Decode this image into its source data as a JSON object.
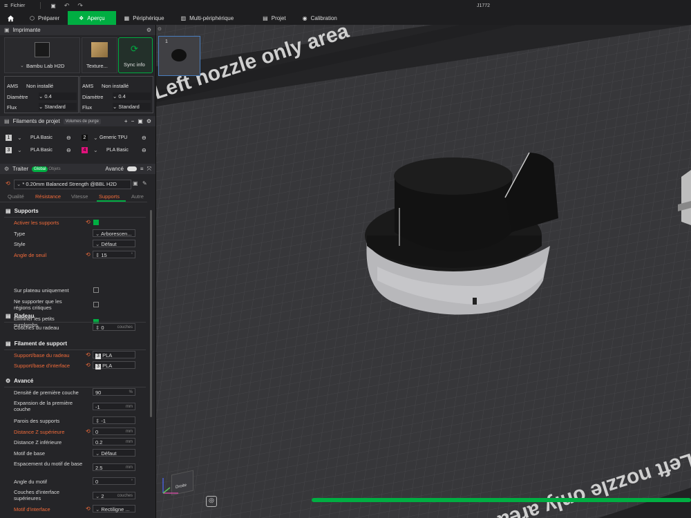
{
  "titlebar": {
    "menu_label": "Fichier",
    "project_name": "J1772"
  },
  "tabs": [
    {
      "label": "Préparer"
    },
    {
      "label": "Aperçu"
    },
    {
      "label": "Périphérique"
    },
    {
      "label": "Multi-périphérique"
    },
    {
      "label": "Projet"
    },
    {
      "label": "Calibration"
    }
  ],
  "printer": {
    "section_title": "Imprimante",
    "printer_name": "Bambu Lab H2D",
    "plate_name": "Texture...",
    "sync_label": "Sync info",
    "left": {
      "ams_label": "AMS",
      "ams_value": "Non installé",
      "diam_label": "Diamètre",
      "diam_value": "0.4",
      "flux_label": "Flux",
      "flux_value": "Standard"
    },
    "right": {
      "ams_label": "AMS",
      "ams_value": "Non installé",
      "diam_label": "Diamètre",
      "diam_value": "0.4",
      "flux_label": "Flux",
      "flux_value": "Standard"
    }
  },
  "filaments": {
    "section_title": "Filaments de projet",
    "purge_label": "Volumes de purge",
    "items": [
      {
        "num": "1",
        "name": "PLA Basic",
        "color": "#cccccc"
      },
      {
        "num": "2",
        "name": "Generic TPU",
        "color": "#111111"
      },
      {
        "num": "3",
        "name": "PLA Basic",
        "color": "#cccccc"
      },
      {
        "num": "4",
        "name": "PLA Basic",
        "color": "#e0137c"
      }
    ]
  },
  "process": {
    "section_title": "Traiter",
    "global_label": "Global",
    "objects_label": "Objets",
    "advanced_label": "Avancé",
    "preset": "* 0.20mm Balanced Strength @BBL H2D",
    "subtabs": [
      "Qualité",
      "Résistance",
      "Vitesse",
      "Supports",
      "Autre"
    ]
  },
  "supports": {
    "title": "Supports",
    "enable_label": "Activer les supports",
    "type_label": "Type",
    "type_value": "Arborescen...",
    "style_label": "Style",
    "style_value": "Défaut",
    "threshold_label": "Angle de seuil",
    "threshold_value": "15",
    "threshold_unit": "°",
    "plate_only_label": "Sur plateau uniquement",
    "critical_label": "Ne supporter que les régions critiques",
    "small_overhang_label": "Éliminer les petits surplombs"
  },
  "raft": {
    "title": "Radeau",
    "layers_label": "Couches du radeau",
    "layers_value": "0",
    "layers_unit": "couches"
  },
  "support_filament": {
    "title": "Filament de support",
    "base_label": "Support/base du radeau",
    "base_num": "3",
    "base_value": "PLA",
    "interface_label": "Support/base d'interface",
    "interface_num": "3",
    "interface_value": "PLA"
  },
  "advanced": {
    "title": "Avancé",
    "density_label": "Densité de première couche",
    "density_value": "90",
    "density_unit": "%",
    "expansion_label": "Expansion de la première couche",
    "expansion_value": "-1",
    "expansion_unit": "mm",
    "walls_label": "Parois des supports",
    "walls_value": "-1",
    "ztop_label": "Distance Z supérieure",
    "ztop_value": "0",
    "ztop_unit": "mm",
    "zbottom_label": "Distance Z inférieure",
    "zbottom_value": "0.2",
    "zbottom_unit": "mm",
    "pattern_label": "Motif de base",
    "pattern_value": "Défaut",
    "spacing_label": "Espacement du motif de base",
    "spacing_value": "2.5",
    "spacing_unit": "mm",
    "angle_label": "Angle du motif",
    "angle_value": "0",
    "angle_unit": "°",
    "top_layers_label": "Couches d'interface supérieures",
    "top_layers_value": "2",
    "top_layers_unit": "couches",
    "interface_pattern_label": "Motif d'interface",
    "interface_pattern_value": "Rectiligne ..."
  },
  "viewport": {
    "plate_label_top": "Left nozzle only area",
    "plate_label_bottom": "Left nozzle only area",
    "thumbnail_num": "1",
    "cube_label": "Droite",
    "progress": 1.0
  }
}
